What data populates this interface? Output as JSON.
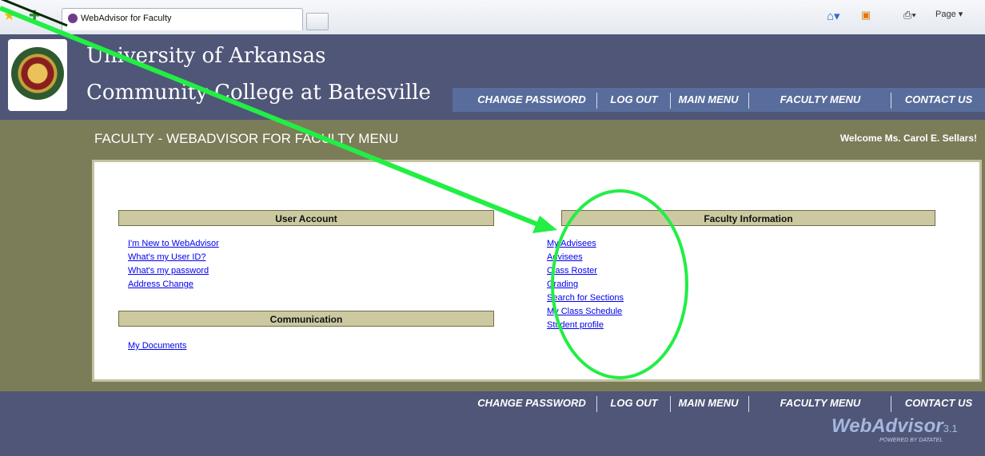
{
  "browser": {
    "tab_title": "WebAdvisor for Faculty",
    "page_menu": "Page"
  },
  "header": {
    "college_line1": "University of Arkansas",
    "college_line2": "Community College at Batesville"
  },
  "nav": {
    "change_password": "CHANGE PASSWORD",
    "log_out": "LOG OUT",
    "main_menu": "MAIN MENU",
    "faculty_menu": "FACULTY MENU",
    "contact_us": "CONTACT US"
  },
  "page": {
    "title": "FACULTY - WEBADVISOR FOR FACULTY MENU",
    "welcome": "Welcome Ms. Carol E. Sellars!"
  },
  "user_account": {
    "heading": "User Account",
    "links": [
      "I'm New to WebAdvisor",
      "What's my User ID?",
      "What's my password",
      "Address Change"
    ]
  },
  "communication": {
    "heading": "Communication",
    "links": [
      "My Documents"
    ]
  },
  "faculty_information": {
    "heading": "Faculty Information",
    "links": [
      "My Advisees",
      "Advisees",
      "Class Roster",
      "Grading",
      "Search for Sections",
      "My Class Schedule",
      "Student profile"
    ]
  },
  "footer": {
    "brand": "WebAdvisor",
    "version": "3.1",
    "powered_by": "POWERED BY DATATEL"
  },
  "colors": {
    "header_bg": "#4f5677",
    "band_bg": "#7b7c58",
    "section_head_bg": "#ccc9a1",
    "link": "#0000ee",
    "annotation": "#22ee44"
  }
}
